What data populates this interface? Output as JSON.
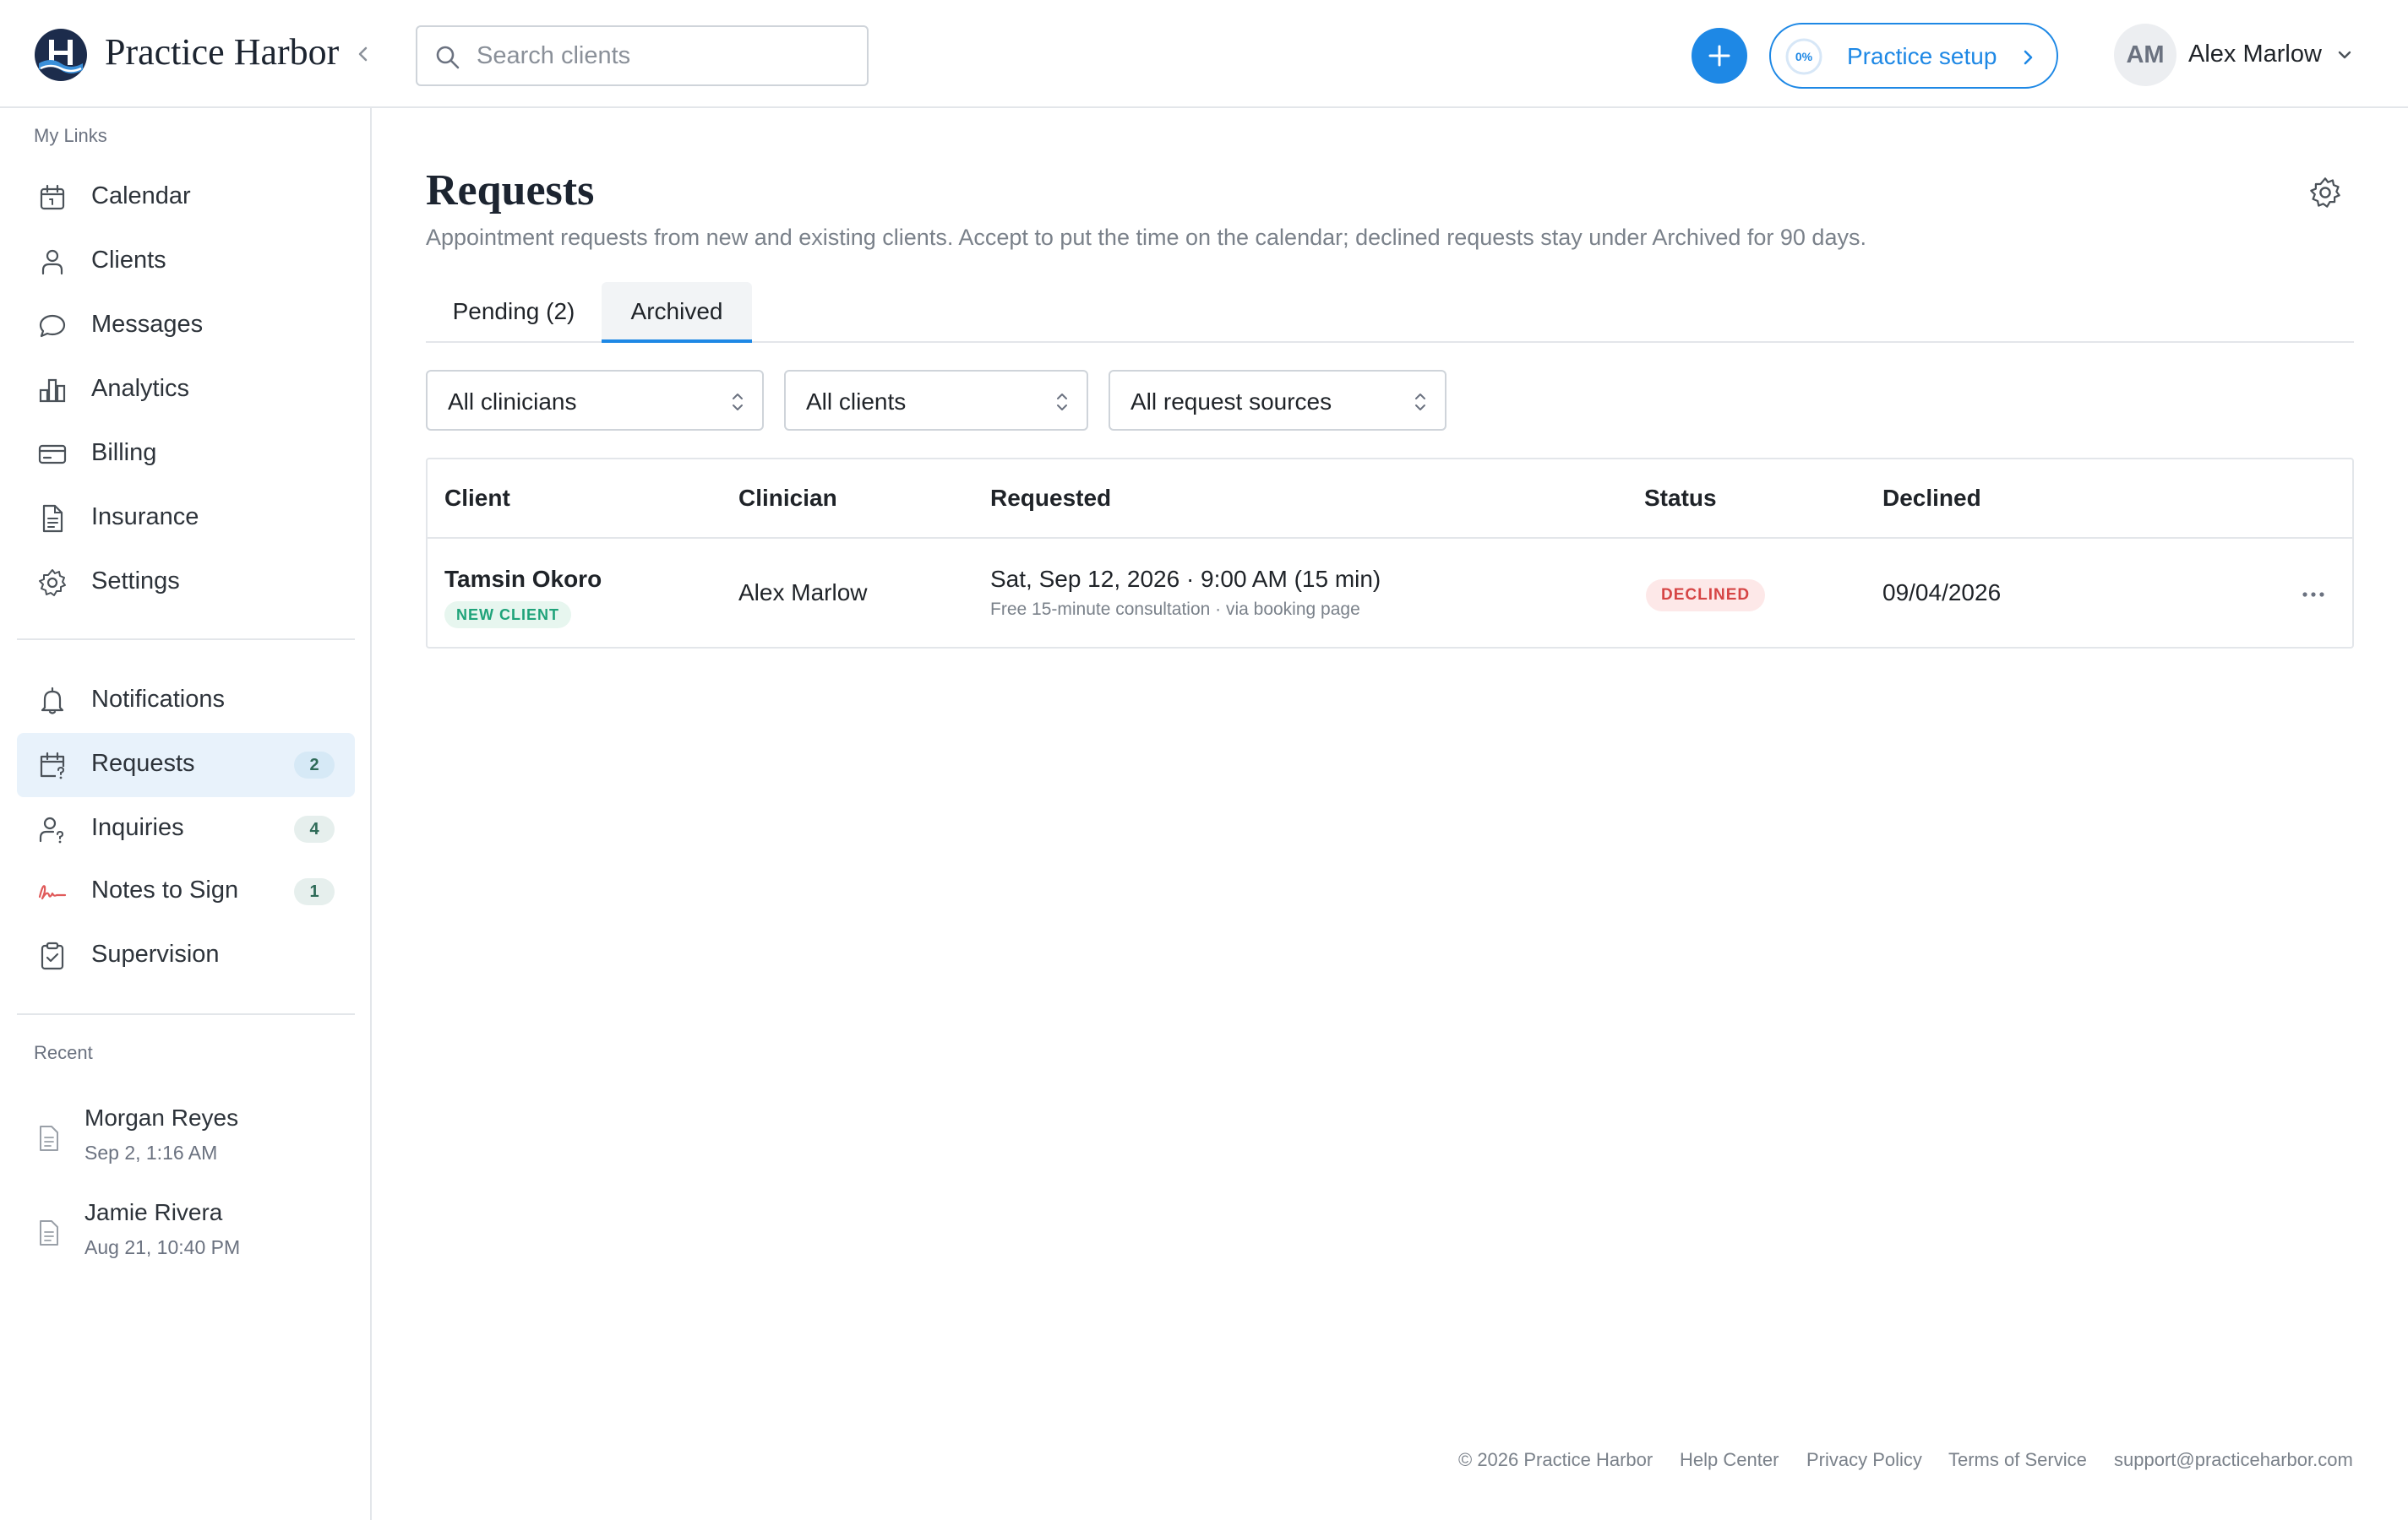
{
  "brand": {
    "name": "Practice Harbor"
  },
  "search": {
    "placeholder": "Search clients"
  },
  "header": {
    "setup": {
      "label": "Practice setup",
      "progress_text": "0%",
      "progress": 0
    },
    "user": {
      "initials": "AM",
      "name": "Alex Marlow"
    }
  },
  "sidebar": {
    "my_links_heading": "My Links",
    "links": [
      {
        "label": "Calendar",
        "icon": "calendar-icon"
      },
      {
        "label": "Clients",
        "icon": "person-icon"
      },
      {
        "label": "Messages",
        "icon": "chat-bubble-icon"
      },
      {
        "label": "Analytics",
        "icon": "bar-chart-icon"
      },
      {
        "label": "Billing",
        "icon": "credit-card-icon"
      },
      {
        "label": "Insurance",
        "icon": "document-icon"
      },
      {
        "label": "Settings",
        "icon": "gear-icon"
      }
    ],
    "tasks": [
      {
        "label": "Notifications",
        "icon": "bell-icon"
      },
      {
        "label": "Requests",
        "icon": "calendar-question-icon",
        "badge": "2",
        "active": true
      },
      {
        "label": "Inquiries",
        "icon": "person-question-icon",
        "badge": "4"
      },
      {
        "label": "Notes to Sign",
        "icon": "signature-icon",
        "badge": "1"
      },
      {
        "label": "Supervision",
        "icon": "clipboard-check-icon"
      }
    ],
    "recent_heading": "Recent",
    "recent": [
      {
        "name": "Morgan Reyes",
        "time": "Sep 2, 1:16 AM"
      },
      {
        "name": "Jamie Rivera",
        "time": "Aug 21, 10:40 PM"
      }
    ]
  },
  "main": {
    "title": "Requests",
    "description": "Appointment requests from new and existing clients. Accept to put the time on the calendar; declined requests stay under Archived for 90 days.",
    "tabs": [
      {
        "label": "Pending (2)",
        "active": false
      },
      {
        "label": "Archived",
        "active": true
      }
    ],
    "filters": [
      "All clinicians",
      "All clients",
      "All request sources"
    ],
    "table": {
      "headers": [
        "Client",
        "Clinician",
        "Requested",
        "Status",
        "Declined"
      ],
      "rows": [
        {
          "client": "Tamsin Okoro",
          "client_badge": "NEW CLIENT",
          "clinician": "Alex Marlow",
          "requested": "Sat, Sep 12, 2026 · 9:00 AM (15 min)",
          "requested_detail": "Free 15-minute consultation · via booking page",
          "status": "DECLINED",
          "declined": "09/04/2026"
        }
      ]
    }
  },
  "footer": {
    "copyright": "© 2026 Practice Harbor",
    "links": [
      "Help Center",
      "Privacy Policy",
      "Terms of Service",
      "support@practiceharbor.com"
    ]
  },
  "colors": {
    "accent": "#1e88e5",
    "active_nav_bg": "#e8f2fb",
    "declined": "#d64545",
    "new_client": "#1fa37a",
    "brand_navy": "#1c2c4c"
  }
}
